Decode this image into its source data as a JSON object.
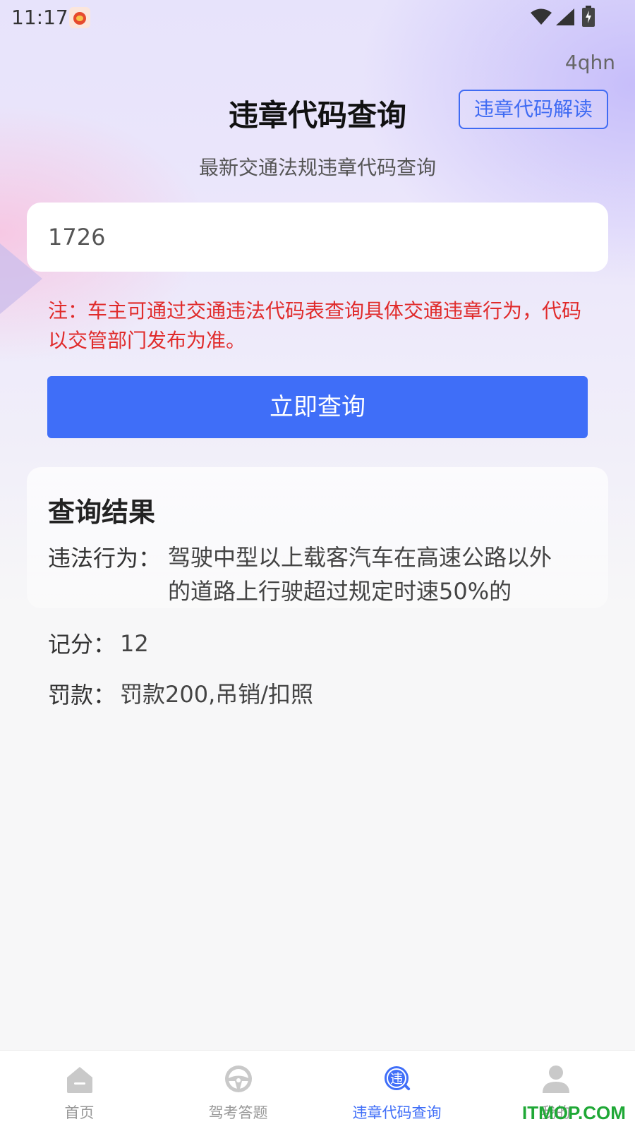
{
  "status_bar": {
    "time": "11:17"
  },
  "header": {
    "user_code": "4qhn",
    "title": "违章代码查询",
    "decode_button": "违章代码解读",
    "subtitle": "最新交通法规违章代码查询"
  },
  "search": {
    "value": "1726",
    "notice": "注：车主可通过交通违法代码表查询具体交通违章行为，代码以交管部门发布为准。",
    "query_button": "立即查询"
  },
  "result": {
    "title": "查询结果",
    "violation_label": "违法行为：",
    "violation_line1": "驾驶中型以上载客汽车在高速公路以外",
    "violation_line2": "的道路上行驶超过规定时速50%的",
    "points_label": "记分：",
    "points_value": "12",
    "fine_label": "罚款：",
    "fine_value": "罚款200,吊销/扣照"
  },
  "tab_bar": {
    "tabs": [
      {
        "label": "首页",
        "icon": "home-icon"
      },
      {
        "label": "驾考答题",
        "icon": "steering-wheel-icon"
      },
      {
        "label": "违章代码查询",
        "icon": "violation-search-icon"
      },
      {
        "label": "我的",
        "icon": "user-icon"
      }
    ],
    "active_tab": "违章代码查询",
    "active_color": "#3f6ef8",
    "inactive_color": "#999999"
  },
  "watermark": "ITMOP.COM"
}
